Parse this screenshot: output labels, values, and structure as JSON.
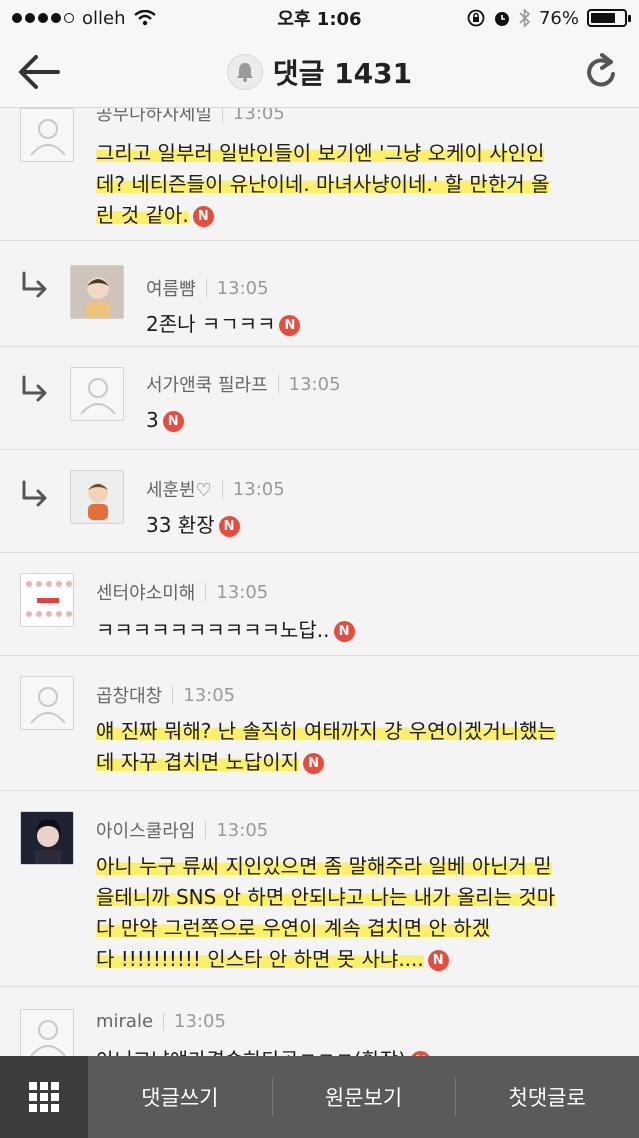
{
  "status_bar": {
    "carrier": "olleh",
    "time": "오후 1:06",
    "battery": "76%",
    "battery_level": 0.76
  },
  "header": {
    "title": "댓글 1431"
  },
  "comments": [
    {
      "author": "공무나하사세밀",
      "time": "13:05",
      "lines": [
        "그리고 일부러 일반인들이 보기엔 '그냥 오케이 사인인",
        "데? 네티즌들이 유난이네. 마녀사냥이네.' 할 만한거 올",
        "린 것 같아."
      ],
      "badge": "N"
    },
    {
      "author": "여름뺨",
      "time": "13:05",
      "lines": [
        "2존나 ㅋㄱㅋㅋ"
      ],
      "badge": "N"
    },
    {
      "author": "서가앤쿡 필라프",
      "time": "13:05",
      "lines": [
        "3"
      ],
      "badge": "N"
    },
    {
      "author": "세훈뷘♡",
      "time": "13:05",
      "lines": [
        "33 환장"
      ],
      "badge": "N"
    },
    {
      "author": "센터야소미해",
      "time": "13:05",
      "lines": [
        "ㅋㅋㅋㅋㅋㅋㅋㅋㅋㅋ노답.."
      ],
      "badge": "N"
    },
    {
      "author": "곱창대창",
      "time": "13:05",
      "lines": [
        "얘 진짜 뭐해? 난 솔직히 여태까지 걍 우연이겠거니했는",
        "데 자꾸 겹치면 노답이지"
      ],
      "badge": "N"
    },
    {
      "author": "아이스쿨라임",
      "time": "13:05",
      "lines": [
        "아니 누구 류씨 지인있으면 좀 말해주라 일베 아닌거 믿",
        "을테니까 SNS 안 하면 안되냐고 나는 내가 올리는 것마",
        "다 만약 그런쪽으로 우연이 계속 겹치면 안 하겠",
        "다 !!!!!!!!!! 인스타 안 하면 못 사냐...."
      ],
      "badge": "N"
    },
    {
      "author": "mirale",
      "time": "13:05",
      "lines": [
        "아니그냥얘가겹솔하다곸ㅋㅋㅋ(환장)"
      ],
      "badge": "N"
    }
  ],
  "bottom_bar": {
    "write": "댓글쓰기",
    "original": "원문보기",
    "first": "첫댓글로"
  },
  "colors": {
    "highlight": "#ffee3c",
    "badge": "#e84c3d",
    "bottom_bar": "#5a5a5a"
  }
}
